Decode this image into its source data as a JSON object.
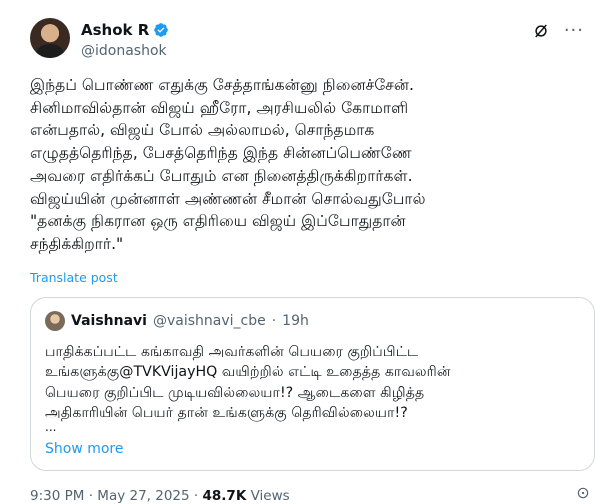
{
  "author": {
    "name": "Ashok R",
    "handle": "@idonashok"
  },
  "post": {
    "text": "இந்தப் பொண்ண எதுக்கு சேத்தாங்கன்னு நினைச்சேன்.\nசினிமாவில்தான் விஜய் ஹீரோ, அரசியலில் கோமாளி\nஎன்பதால், விஜய் போல் அல்லாமல், சொந்தமாக\nஎழுதத்தெரிந்த, பேசத்தெரிந்த இந்த சின்னப்பெண்ணே\nஅவரை எதிர்க்கப் போதும் என நினைத்திருக்கிறார்கள்.\nவிஜய்யின் முன்னாள் அண்ணன் சீமான் சொல்வதுபோல்\n\"தனக்கு நிகரான ஒரு எதிரியை விஜய் இப்போதுதான்\nசந்திக்கிறார்.\"",
    "translate_label": "Translate post"
  },
  "quoted": {
    "name": "Vaishnavi",
    "handle": "@vaishnavi_cbe",
    "separator": "·",
    "time": "19h",
    "text": "பாதிக்கப்பட்ட கங்காவதி அவர்களின் பெயரை குறிப்பிட்ட\nஉங்களுக்கு@TVKVijayHQ வயிற்றில் எட்டி உதைத்த காவலரின்\nபெயரை குறிப்பிட முடியவில்லையா!? ஆடைகளை கிழித்த\nஅதிகாரியின் பெயர் தான் உங்களுக்கு தெரிவில்லையா!?",
    "ellipsis": "...",
    "show_more_label": "Show more"
  },
  "meta": {
    "time": "9:30 PM",
    "date": "May 27, 2025",
    "separator": "·",
    "views_count": "48.7K",
    "views_label": "Views"
  },
  "colors": {
    "accent": "#1d9bf0",
    "muted": "#536471",
    "text": "#0f1419",
    "border": "#cfd9de"
  }
}
